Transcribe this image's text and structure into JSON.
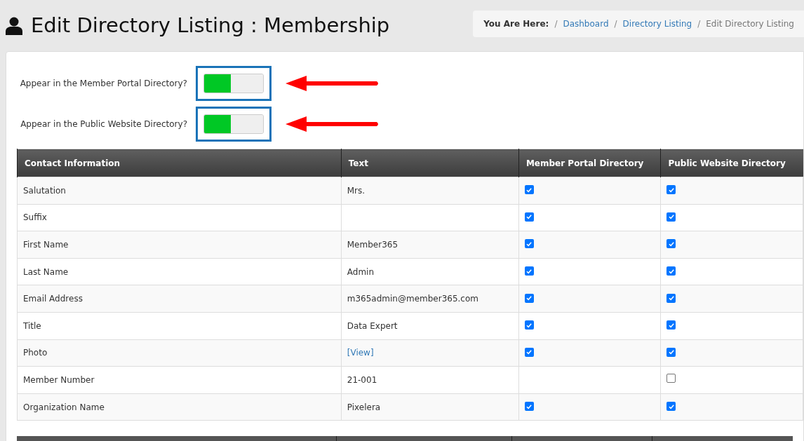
{
  "page_title": "Edit Directory Listing : Membership",
  "breadcrumb": {
    "label": "You Are Here:",
    "separator": "/",
    "items": [
      {
        "text": "Dashboard",
        "kind": "link"
      },
      {
        "text": "Directory Listing",
        "kind": "link"
      },
      {
        "text": "Edit Directory Listing",
        "kind": "current"
      }
    ]
  },
  "toggles": [
    {
      "label": "Appear in the Member Portal Directory?",
      "on": true,
      "annotated": true
    },
    {
      "label": "Appear in the Public Website Directory?",
      "on": true,
      "annotated": true
    }
  ],
  "table": {
    "columns": [
      "Contact Information",
      "Text",
      "Member Portal Directory",
      "Public Website Directory"
    ],
    "rows": [
      {
        "field": "Salutation",
        "text": "Mrs.",
        "link": false,
        "member_portal": {
          "checked": true
        },
        "public_website": {
          "checked": true
        }
      },
      {
        "field": "Suffix",
        "member_portal": {
          "checked": true
        },
        "public_website": {
          "checked": true
        }
      },
      {
        "field": "First Name",
        "text": "Member365",
        "link": false,
        "member_portal": {
          "checked": true
        },
        "public_website": {
          "checked": true
        }
      },
      {
        "field": "Last Name",
        "text": "Admin",
        "link": false,
        "member_portal": {
          "checked": true
        },
        "public_website": {
          "checked": true
        }
      },
      {
        "field": "Email Address",
        "text": "m365admin@member365.com",
        "link": false,
        "member_portal": {
          "checked": true
        },
        "public_website": {
          "checked": true
        }
      },
      {
        "field": "Title",
        "text": "Data Expert",
        "link": false,
        "member_portal": {
          "checked": true
        },
        "public_website": {
          "checked": true
        }
      },
      {
        "field": "Photo",
        "text": "[View]",
        "link": true,
        "member_portal": {
          "checked": true
        },
        "public_website": {
          "checked": true
        }
      },
      {
        "field": "Member Number",
        "text": "21-001",
        "link": false,
        "public_website": {
          "checked": false
        }
      },
      {
        "field": "Organization Name",
        "text": "Pixelera",
        "link": false,
        "member_portal": {
          "checked": true
        },
        "public_website": {
          "checked": true
        }
      }
    ]
  }
}
